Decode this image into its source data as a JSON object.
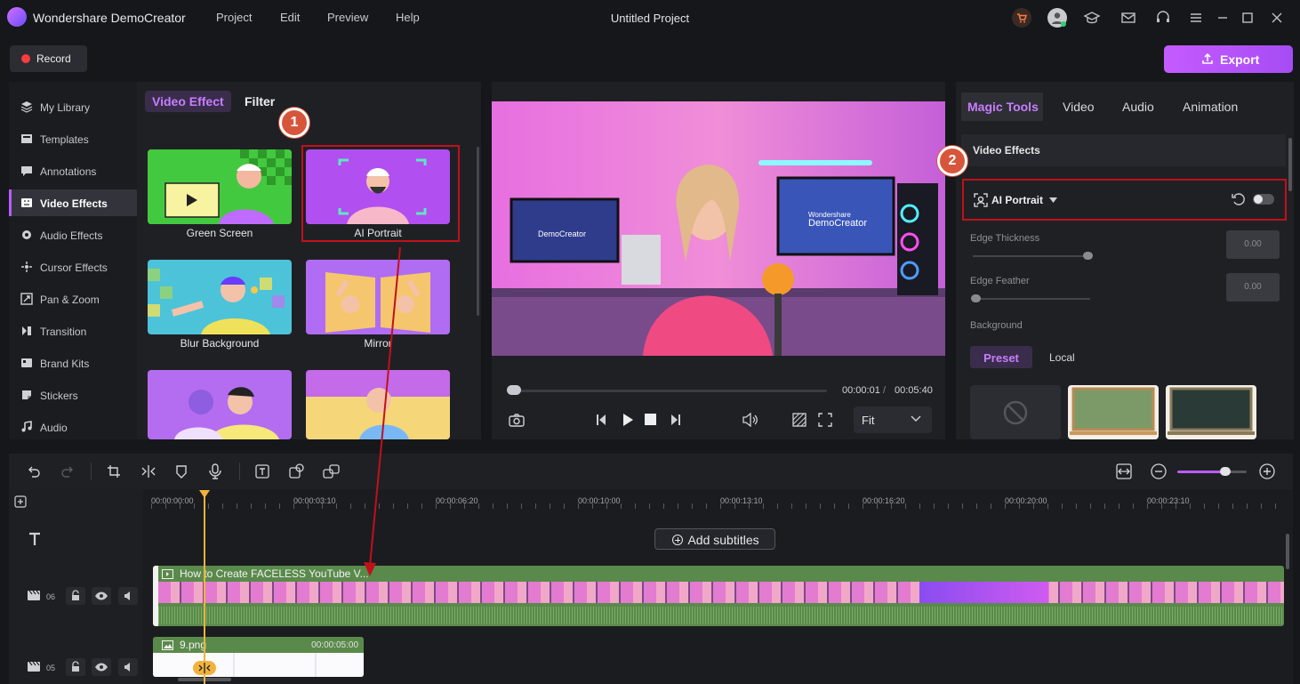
{
  "titlebar": {
    "app_name": "Wondershare DemoCreator",
    "menu": [
      "Project",
      "Edit",
      "Preview",
      "Help"
    ],
    "project_title": "Untitled Project"
  },
  "toolbar": {
    "record_label": "Record",
    "export_label": "Export"
  },
  "sidebar": {
    "items": [
      {
        "label": "My Library",
        "icon": "layers-icon"
      },
      {
        "label": "Templates",
        "icon": "templates-icon"
      },
      {
        "label": "Annotations",
        "icon": "annotation-icon"
      },
      {
        "label": "Video Effects",
        "icon": "video-effects-icon",
        "active": true
      },
      {
        "label": "Audio Effects",
        "icon": "audio-effects-icon"
      },
      {
        "label": "Cursor Effects",
        "icon": "cursor-icon"
      },
      {
        "label": "Pan & Zoom",
        "icon": "pan-zoom-icon"
      },
      {
        "label": "Transition",
        "icon": "transition-icon"
      },
      {
        "label": "Brand Kits",
        "icon": "brand-kit-icon"
      },
      {
        "label": "Stickers",
        "icon": "sticker-icon"
      },
      {
        "label": "Audio",
        "icon": "music-icon"
      }
    ]
  },
  "effects": {
    "tabs": [
      "Video Effect",
      "Filter"
    ],
    "cards": [
      "Green Screen",
      "AI Portrait",
      "Blur Background",
      "Mirror"
    ]
  },
  "callouts": [
    "1",
    "2"
  ],
  "preview": {
    "current_time": "00:00:01",
    "total_time": "00:05:40",
    "zoom_mode": "Fit",
    "screen_brand_1": "Wondershare",
    "screen_brand_2": "DemoCreator"
  },
  "right_panel": {
    "tabs": [
      "Magic Tools",
      "Video",
      "Audio",
      "Animation"
    ],
    "section_title": "Video Effects",
    "effect_name": "AI Portrait",
    "edge_thickness_label": "Edge Thickness",
    "edge_thickness_value": "0.00",
    "edge_feather_label": "Edge Feather",
    "edge_feather_value": "0.00",
    "background_label": "Background",
    "bg_tabs": [
      "Preset",
      "Local"
    ]
  },
  "timeline": {
    "ruler": [
      "00:00:00:00",
      "00:00:03:10",
      "00:00:06:20",
      "00:00:10:00",
      "00:00:13:10",
      "00:00:16:20",
      "00:00:20:00",
      "00:00:23:10"
    ],
    "add_subtitles": "Add subtitles",
    "video_clip_title": "How to Create FACELESS YouTube V...",
    "image_clip_title": "9.png",
    "image_clip_duration": "00:00:05:00",
    "track_numbers": [
      "06",
      "05"
    ]
  },
  "colors": {
    "accent": "#c77dff",
    "highlight": "#c0111b",
    "clip": "#5a8a4b",
    "playhead": "#f2b33d"
  }
}
